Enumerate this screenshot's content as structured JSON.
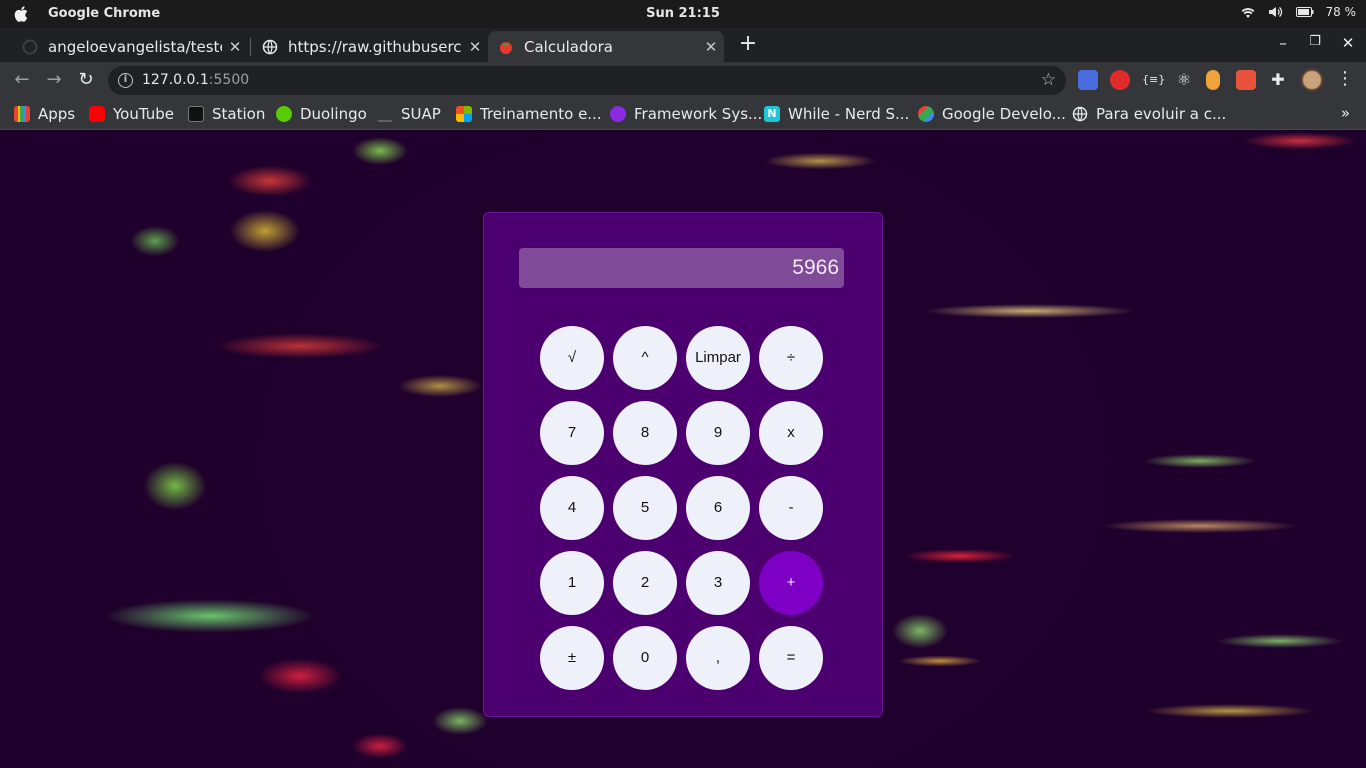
{
  "os_bar": {
    "app_name": "Google Chrome",
    "clock": "Sun 21:15",
    "battery": "78 %"
  },
  "tabs": [
    {
      "title": "angeloevangelista/teste-c",
      "close": "✕",
      "icon": "github-icon"
    },
    {
      "title": "https://raw.githubusercon",
      "close": "✕",
      "icon": "globe-icon"
    },
    {
      "title": "Calculadora",
      "close": "✕",
      "icon": "tomato-icon",
      "active": true
    }
  ],
  "toolbar": {
    "url_host": "127.0.0.1",
    "url_port": ":5500"
  },
  "bookmarks": [
    {
      "label": "Apps",
      "icon": "apps-grid-icon"
    },
    {
      "label": "YouTube",
      "icon": "youtube-icon"
    },
    {
      "label": "Station",
      "icon": "station-icon"
    },
    {
      "label": "Duolingo",
      "icon": "duolingo-icon"
    },
    {
      "label": "SUAP",
      "icon": "suap-icon"
    },
    {
      "label": "Treinamento e...",
      "icon": "microsoft-icon"
    },
    {
      "label": "Framework Sys...",
      "icon": "chat-bubble-icon"
    },
    {
      "label": "While - Nerd S...",
      "icon": "n-logo-icon"
    },
    {
      "label": "Google Develo...",
      "icon": "google-developers-icon"
    },
    {
      "label": "Para evoluir a c...",
      "icon": "globe-icon"
    }
  ],
  "bookmarks_more": "»",
  "calculator": {
    "display": "5966",
    "keys": [
      [
        "√",
        "^",
        "Limpar",
        "÷"
      ],
      [
        "7",
        "8",
        "9",
        "x"
      ],
      [
        "4",
        "5",
        "6",
        "-"
      ],
      [
        "1",
        "2",
        "3",
        "+"
      ],
      [
        "±",
        "0",
        ",",
        "="
      ]
    ],
    "accent_color": "#7d00c4"
  },
  "colors": {
    "calc_background": "#4c0070",
    "display_background": "#7f4a97",
    "key_background": "#eef1fa"
  }
}
